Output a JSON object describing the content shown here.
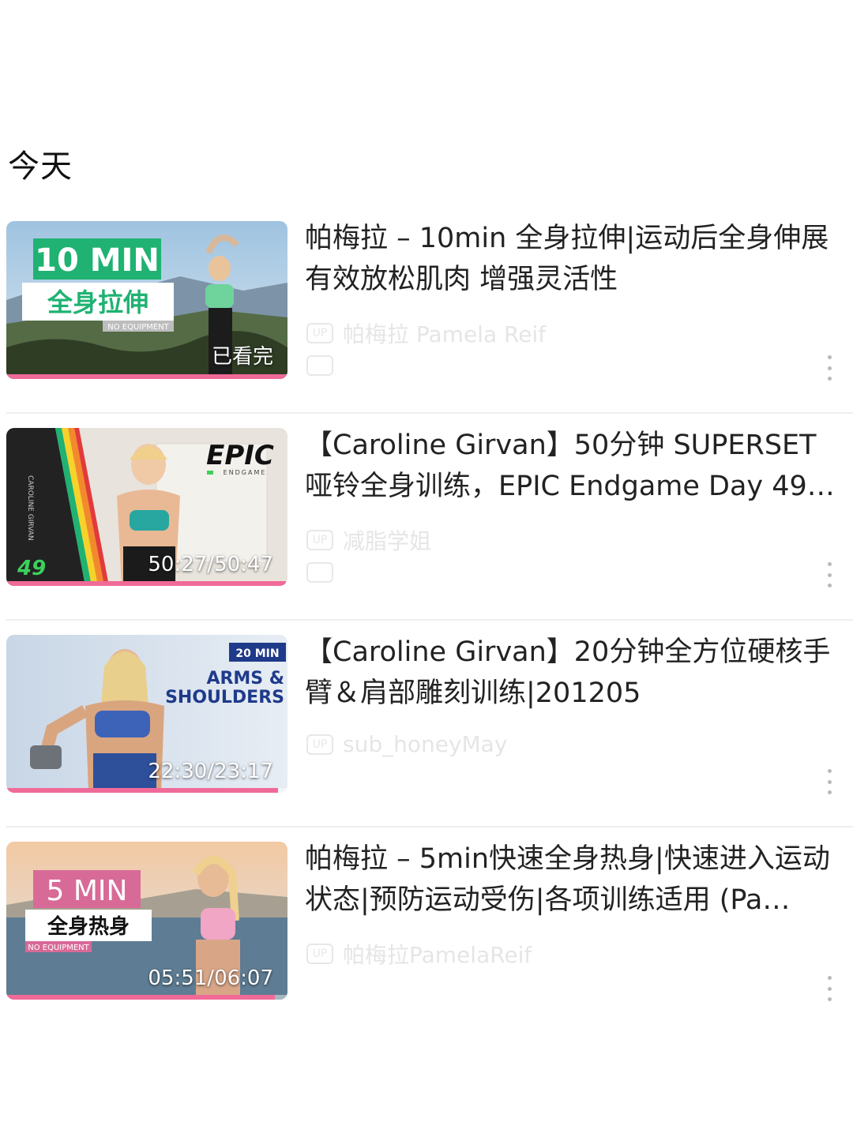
{
  "section": {
    "title": "今天"
  },
  "items": [
    {
      "title": "帕梅拉 – 10min 全身拉伸|运动后全身伸展有效放松肌肉 增强灵活性",
      "badge": "已看完",
      "thumb_text": {
        "big": "10 MIN",
        "sub": "全身拉伸",
        "small": "NO EQUIPMENT"
      },
      "uploader": "帕梅拉 Pamela Reif",
      "progress": 1.0
    },
    {
      "title": "【Caroline Girvan】50分钟 SUPERSET 哑铃全身训练，EPIC Endgame Day 49…",
      "badge": "50:27/50:47",
      "thumb_text": {
        "logo": "EPIC",
        "logo_sub": "ENDGAME",
        "day": "49",
        "side": "CAROLINE GIRVAN"
      },
      "uploader": "减脂学姐",
      "progress": 0.993
    },
    {
      "title": "【Caroline Girvan】20分钟全方位硬核手臂＆肩部雕刻训练|201205",
      "badge": "22:30/23:17",
      "thumb_text": {
        "min": "20 MIN",
        "line1": "ARMS &",
        "line2": "SHOULDERS"
      },
      "uploader": "sub_honeyMay",
      "progress": 0.966
    },
    {
      "title": "帕梅拉 – 5min快速全身热身|快速进入运动状态|预防运动受伤|各项训练适用 (Pa…",
      "badge": "05:51/06:07",
      "thumb_text": {
        "big": "5 MIN",
        "sub": "全身热身",
        "small": "NO EQUIPMENT"
      },
      "uploader": "帕梅拉PamelaReif",
      "progress": 0.956
    }
  ],
  "colors": {
    "accent": "#f06a98",
    "green": "#1fb272",
    "pink": "#d86a98",
    "navy": "#1f3a8a"
  }
}
